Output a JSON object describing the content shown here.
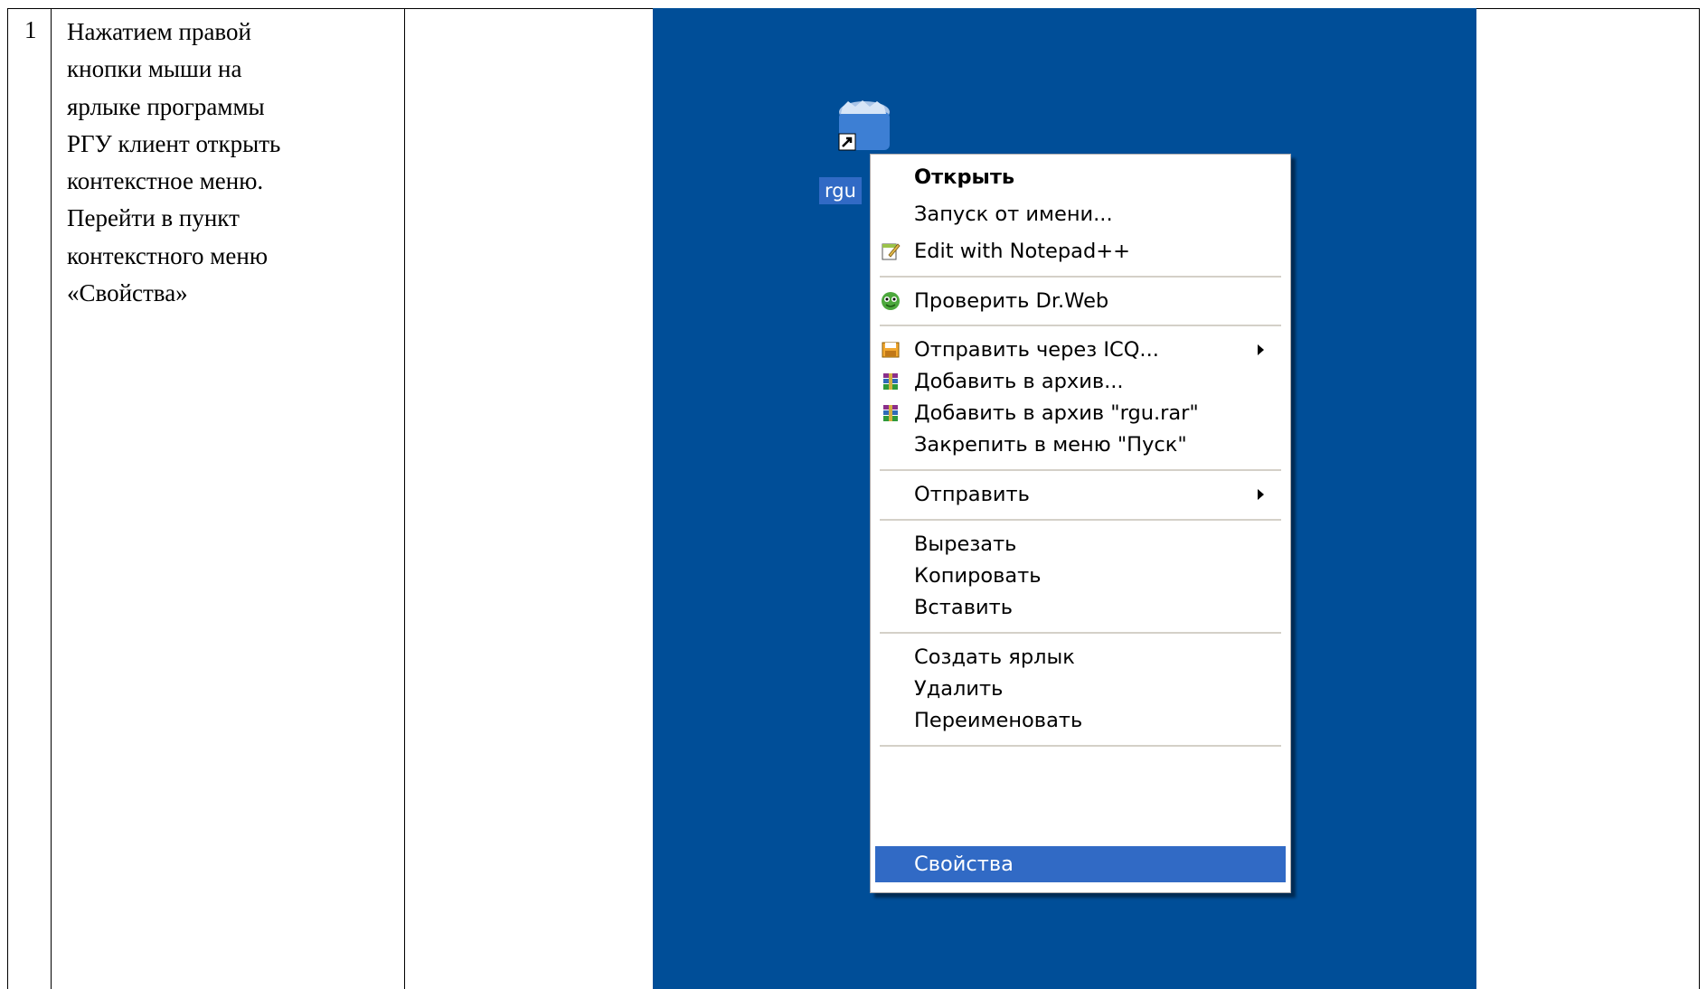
{
  "step": {
    "number": "1",
    "text": "Нажатием правой\nкнопки мыши на\nярлыке программы\nРГУ клиент открыть\nконтекстное меню.\nПерейти в пункт\nконтекстного меню\n«Свойства»"
  },
  "desktop": {
    "background": "#004e98",
    "icon": {
      "name": "rgu-shortcut-icon",
      "label": "rgu"
    }
  },
  "context_menu": {
    "items": [
      {
        "label": "Открыть",
        "bold": true,
        "icon": "",
        "submenu": false
      },
      {
        "label": "Запуск от имени...",
        "bold": false,
        "icon": "",
        "submenu": false
      },
      {
        "label": "Edit with Notepad++",
        "bold": false,
        "icon": "notepad-plus-plus-icon",
        "submenu": false
      },
      {
        "label": "Проверить Dr.Web",
        "bold": false,
        "icon": "drweb-icon",
        "submenu": false
      },
      {
        "label": "Отправить через ICQ...",
        "bold": false,
        "icon": "icq-send-icon",
        "submenu": true
      },
      {
        "label": "Добавить в архив...",
        "bold": false,
        "icon": "winrar-icon",
        "submenu": false
      },
      {
        "label": "Добавить в архив \"rgu.rar\"",
        "bold": false,
        "icon": "winrar-icon",
        "submenu": false
      },
      {
        "label": "Закрепить в меню \"Пуск\"",
        "bold": false,
        "icon": "",
        "submenu": false
      },
      {
        "label": "Отправить",
        "bold": false,
        "icon": "",
        "submenu": true
      },
      {
        "label": "Вырезать",
        "bold": false,
        "icon": "",
        "submenu": false
      },
      {
        "label": "Копировать",
        "bold": false,
        "icon": "",
        "submenu": false
      },
      {
        "label": "Вставить",
        "bold": false,
        "icon": "",
        "submenu": false
      },
      {
        "label": "Создать ярлык",
        "bold": false,
        "icon": "",
        "submenu": false
      },
      {
        "label": "Удалить",
        "bold": false,
        "icon": "",
        "submenu": false
      },
      {
        "label": "Переименовать",
        "bold": false,
        "icon": "",
        "submenu": false
      },
      {
        "label": "Свойства",
        "bold": false,
        "icon": "",
        "submenu": false,
        "selected": true
      }
    ],
    "highlight_color": "#316ac5"
  }
}
